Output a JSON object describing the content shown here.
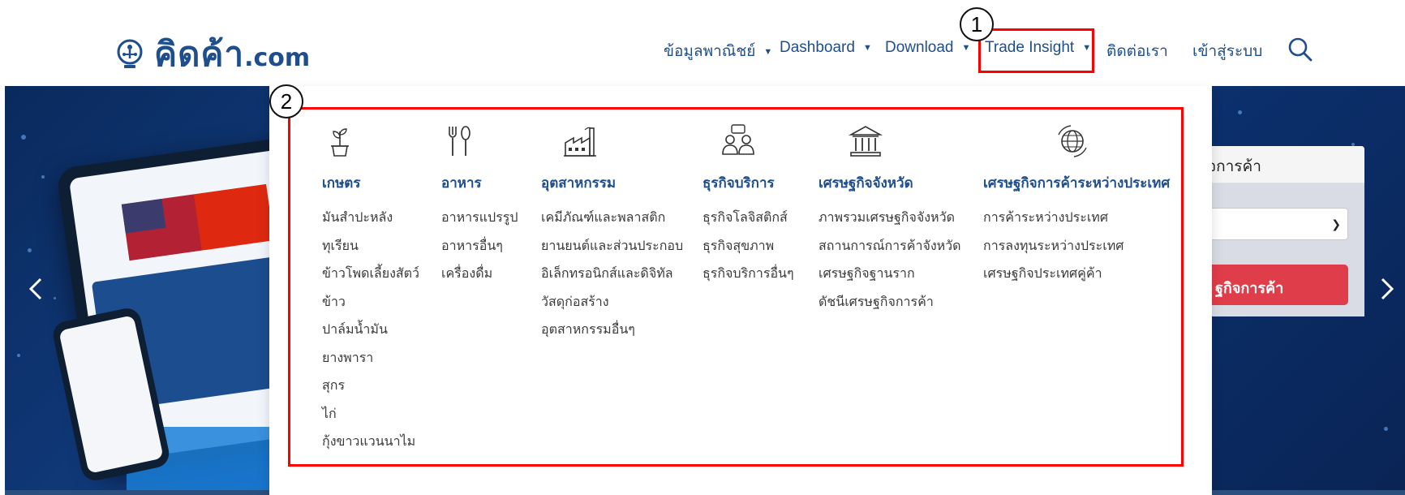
{
  "logo": {
    "main": "คิดค้า",
    "suffix": ".com"
  },
  "nav": {
    "items": [
      {
        "label": "ข้อมูลพาณิชย์",
        "dropdown": true
      },
      {
        "label": "Dashboard",
        "dropdown": true
      },
      {
        "label": "Download",
        "dropdown": true
      },
      {
        "label": "Trade Insight",
        "dropdown": true
      },
      {
        "label": "ติดต่อเรา",
        "dropdown": false
      },
      {
        "label": "เข้าสู่ระบบ",
        "dropdown": false
      }
    ],
    "search_icon": "search-icon"
  },
  "side_card": {
    "title": "จการค้า",
    "button_label": "ฐกิจการค้า"
  },
  "mega_menu": {
    "categories": [
      {
        "icon": "plant-icon",
        "title": "เกษตร",
        "items": [
          "มันสำปะหลัง",
          "ทุเรียน",
          "ข้าวโพดเลี้ยงสัตว์",
          "ข้าว",
          "ปาล์มน้ำมัน",
          "ยางพารา",
          "สุกร",
          "ไก่",
          "กุ้งขาวแวนนาไม"
        ]
      },
      {
        "icon": "fork-spoon-icon",
        "title": "อาหาร",
        "items": [
          "อาหารแปรรูป",
          "อาหารอื่นๆ",
          "เครื่องดื่ม"
        ]
      },
      {
        "icon": "factory-icon",
        "title": "อุตสาหกรรม",
        "items": [
          "เคมีภัณฑ์และพลาสติก",
          "ยานยนต์และส่วนประกอบ",
          "อิเล็กทรอนิกส์และดิจิทัล",
          "วัสดุก่อสร้าง",
          "อุตสาหกรรมอื่นๆ"
        ]
      },
      {
        "icon": "people-chat-icon",
        "title": "ธุรกิจบริการ",
        "items": [
          "ธุรกิจโลจิสติกส์",
          "ธุรกิจสุขภาพ",
          "ธุรกิจบริการอื่นๆ"
        ]
      },
      {
        "icon": "bank-icon",
        "title": "เศรษฐกิจจังหวัด",
        "items": [
          "ภาพรวมเศรษฐกิจจังหวัด",
          "สถานการณ์การค้าจังหวัด",
          "เศรษฐกิจฐานราก",
          "ดัชนีเศรษฐกิจการค้า"
        ]
      },
      {
        "icon": "globe-icon",
        "title": "เศรษฐกิจการค้าระหว่างประเทศ",
        "items": [
          "การค้าระหว่างประเทศ",
          "การลงทุนระหว่างประเทศ",
          "เศรษฐกิจประเทศคู่ค้า"
        ]
      }
    ]
  },
  "annotations": [
    "1",
    "2"
  ],
  "colors": {
    "brand": "#1f4e8c",
    "hero": "#0b2f6b",
    "accent_red": "#e03d4a",
    "annotation": "#ff0000"
  }
}
